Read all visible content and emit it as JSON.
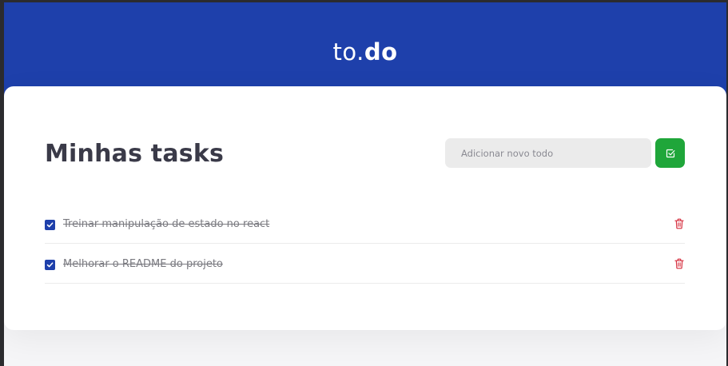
{
  "header": {
    "logo_light": "to.",
    "logo_bold": "do"
  },
  "main": {
    "title": "Minhas tasks",
    "new_todo": {
      "placeholder": "Adicionar novo todo",
      "value": ""
    }
  },
  "tasks": [
    {
      "text": "Treinar manipulação de estado no react",
      "done": true
    },
    {
      "text": "Melhorar o README do projeto",
      "done": true
    }
  ],
  "colors": {
    "brand_blue": "#1e40ab",
    "add_green": "#1fa63a",
    "delete_red": "#d62f3f"
  },
  "icons": {
    "add": "check-square-icon",
    "done": "checkmark-icon",
    "delete": "trash-icon"
  }
}
